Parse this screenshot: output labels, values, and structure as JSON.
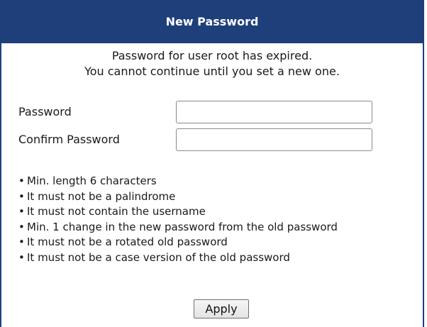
{
  "dialog": {
    "title": "New Password",
    "message_line1": "Password for user root has expired.",
    "message_line2": "You cannot continue until you set a new one."
  },
  "form": {
    "password_label": "Password",
    "password_value": "",
    "confirm_label": "Confirm Password",
    "confirm_value": ""
  },
  "rules": [
    "Min. length 6 characters",
    "It must not be a palindrome",
    "It must not contain the username",
    "Min. 1 change in the new password from the old password",
    "It must not be a rotated old password",
    "It must not be a case version of the old password"
  ],
  "buttons": {
    "apply_label": "Apply"
  },
  "colors": {
    "header_bg": "#1e3f7a",
    "header_text": "#ffffff",
    "border": "#1e3f7a"
  }
}
